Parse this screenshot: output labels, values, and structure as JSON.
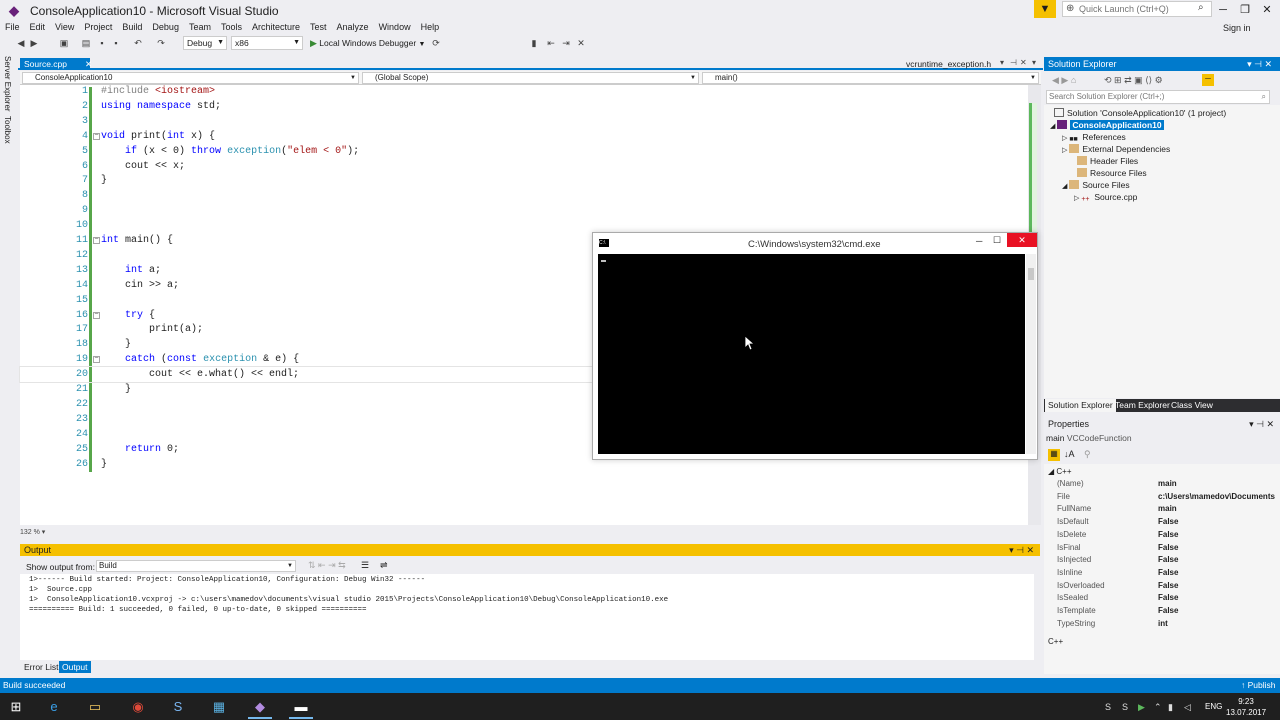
{
  "window": {
    "title": "ConsoleApplication10 - Microsoft Visual Studio",
    "quick_launch_placeholder": "Quick Launch (Ctrl+Q)",
    "sign_in": "Sign in"
  },
  "menu": [
    "File",
    "Edit",
    "View",
    "Project",
    "Build",
    "Debug",
    "Team",
    "Tools",
    "Architecture",
    "Test",
    "Analyze",
    "Window",
    "Help"
  ],
  "toolbar": {
    "config": "Debug",
    "platform": "x86",
    "run_label": "Local Windows Debugger"
  },
  "left_tabs": [
    "Server Explorer",
    "Toolbox"
  ],
  "editor": {
    "active_tab": "Source.cpp",
    "other_tab": "vcruntime_exception.h",
    "nav_project": "ConsoleApplication10",
    "nav_scope": "(Global Scope)",
    "nav_member": "main()",
    "zoom": "132 %",
    "lines": [
      {
        "n": "1",
        "code": "#include <iostream>"
      },
      {
        "n": "2",
        "code": "using namespace std;"
      },
      {
        "n": "3",
        "code": ""
      },
      {
        "n": "4",
        "code": "void print(int x) {"
      },
      {
        "n": "5",
        "code": "    if (x < 0) throw exception(\"elem < 0\");"
      },
      {
        "n": "6",
        "code": "    cout << x;"
      },
      {
        "n": "7",
        "code": "}"
      },
      {
        "n": "8",
        "code": ""
      },
      {
        "n": "9",
        "code": ""
      },
      {
        "n": "10",
        "code": ""
      },
      {
        "n": "11",
        "code": "int main() {"
      },
      {
        "n": "12",
        "code": ""
      },
      {
        "n": "13",
        "code": "    int a;"
      },
      {
        "n": "14",
        "code": "    cin >> a;"
      },
      {
        "n": "15",
        "code": ""
      },
      {
        "n": "16",
        "code": "    try {"
      },
      {
        "n": "17",
        "code": "        print(a);"
      },
      {
        "n": "18",
        "code": "    }"
      },
      {
        "n": "19",
        "code": "    catch (const exception & e) {"
      },
      {
        "n": "20",
        "code": "        cout << e.what() << endl;"
      },
      {
        "n": "21",
        "code": "    }"
      },
      {
        "n": "22",
        "code": ""
      },
      {
        "n": "23",
        "code": ""
      },
      {
        "n": "24",
        "code": ""
      },
      {
        "n": "25",
        "code": "    return 0;"
      },
      {
        "n": "26",
        "code": "}"
      }
    ]
  },
  "cmd": {
    "title": "C:\\Windows\\system32\\cmd.exe"
  },
  "solution_explorer": {
    "title": "Solution Explorer",
    "search_placeholder": "Search Solution Explorer (Ctrl+;)",
    "items": [
      {
        "label": "Solution 'ConsoleApplication10' (1 project)"
      },
      {
        "label": "ConsoleApplication10"
      },
      {
        "label": "References"
      },
      {
        "label": "External Dependencies"
      },
      {
        "label": "Header Files"
      },
      {
        "label": "Resource Files"
      },
      {
        "label": "Source Files"
      },
      {
        "label": "Source.cpp"
      }
    ],
    "tabs": [
      "Solution Explorer",
      "Team Explorer",
      "Class View"
    ]
  },
  "properties": {
    "title": "Properties",
    "object": "main",
    "object_type": "VCCodeFunction",
    "category": "C++",
    "footer": "C++",
    "rows": [
      {
        "name": "(Name)",
        "value": "main"
      },
      {
        "name": "File",
        "value": "c:\\Users\\mamedov\\Documents"
      },
      {
        "name": "FullName",
        "value": "main"
      },
      {
        "name": "IsDefault",
        "value": "False"
      },
      {
        "name": "IsDelete",
        "value": "False"
      },
      {
        "name": "IsFinal",
        "value": "False"
      },
      {
        "name": "IsInjected",
        "value": "False"
      },
      {
        "name": "IsInline",
        "value": "False"
      },
      {
        "name": "IsOverloaded",
        "value": "False"
      },
      {
        "name": "IsSealed",
        "value": "False"
      },
      {
        "name": "IsTemplate",
        "value": "False"
      },
      {
        "name": "TypeString",
        "value": "int"
      }
    ]
  },
  "output": {
    "title": "Output",
    "show_from_label": "Show output from:",
    "source": "Build",
    "lines": [
      "1>------ Build started: Project: ConsoleApplication10, Configuration: Debug Win32 ------",
      "1>  Source.cpp",
      "1>  ConsoleApplication10.vcxproj -> c:\\users\\mamedov\\documents\\visual studio 2015\\Projects\\ConsoleApplication10\\Debug\\ConsoleApplication10.exe",
      "========== Build: 1 succeeded, 0 failed, 0 up-to-date, 0 skipped =========="
    ],
    "tabs": [
      "Error List",
      "Output"
    ]
  },
  "status": {
    "text": "Build succeeded",
    "publish": "Publish"
  },
  "taskbar": {
    "lang": "ENG",
    "time": "9:23",
    "date": "13.07.2017"
  },
  "colors": {
    "accent": "#007acc",
    "output_header": "#f5c000",
    "cmd_close": "#e81123"
  }
}
